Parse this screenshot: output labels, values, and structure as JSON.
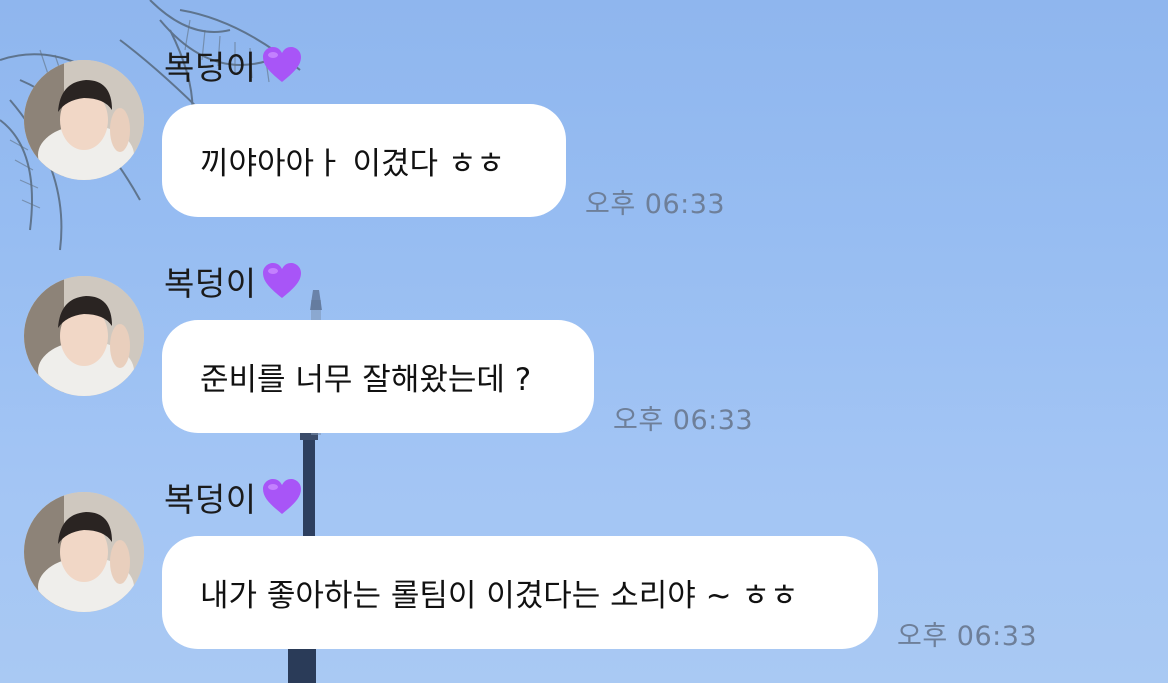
{
  "messages": [
    {
      "sender": "복덩이",
      "text": "끼야아아ㅏ 이겼다 ㅎㅎ",
      "time": "오후 06:33"
    },
    {
      "sender": "복덩이",
      "text": "준비를 너무 잘해왔는데 ?",
      "time": "오후 06:33"
    },
    {
      "sender": "복덩이",
      "text": "내가 좋아하는 롤팀이 이겼다는 소리야 ~ ㅎㅎ",
      "time": "오후 06:33"
    }
  ],
  "colors": {
    "bubble": "#ffffff",
    "timestamp": "#6e7f99",
    "heart": "#a855f7"
  },
  "icons": {
    "heart": "purple-heart-icon"
  }
}
